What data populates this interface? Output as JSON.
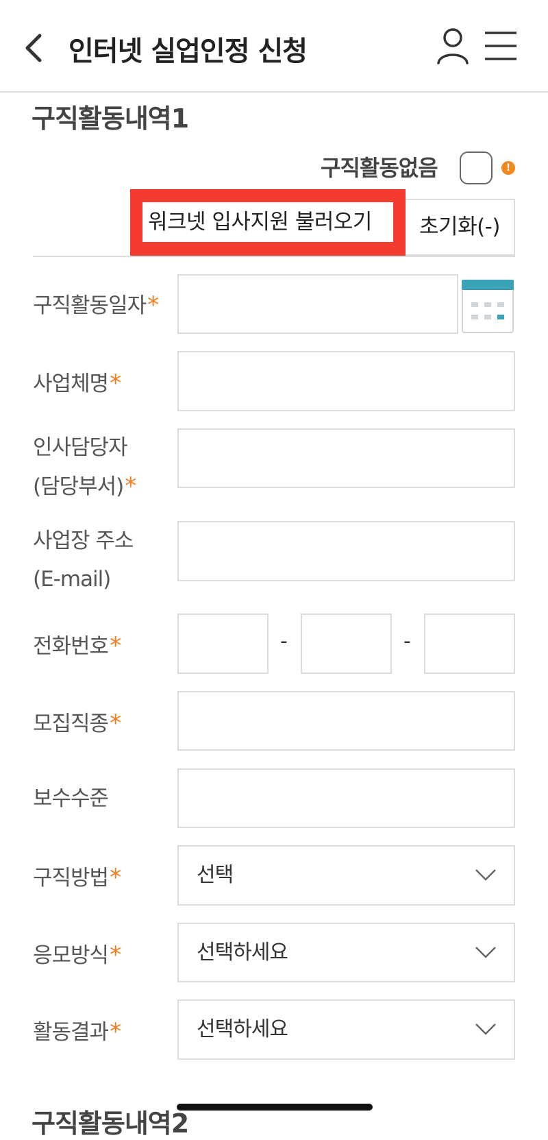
{
  "header": {
    "title": "인터넷 실업인정 신청"
  },
  "section": {
    "title": "구직활동내역1",
    "no_activity_label": "구직활동없음",
    "worknet_button": "워크넷 입사지원 불러오기",
    "reset_button": "초기화(-)"
  },
  "form": {
    "required_mark": "*",
    "activity_date_label": "구직활동일자",
    "company_name_label": "사업체명",
    "hr_manager_label": [
      "인사담당자",
      "(담당부서)"
    ],
    "address_label": [
      "사업장 주소",
      "(E-mail)"
    ],
    "phone_label": "전화번호",
    "phone_separator": "-",
    "job_type_label": "모집직종",
    "salary_label": "보수수준",
    "job_method_label": "구직방법",
    "job_method_value": "선택",
    "apply_method_label": "응모방식",
    "apply_method_value": "선택하세요",
    "result_label": "활동결과",
    "result_value": "선택하세요"
  },
  "next_section": {
    "title": "구직활동내역2"
  },
  "colors": {
    "accent": "#ef7d22",
    "highlight": "#f43b2f",
    "calendar": "#3aa3b8"
  },
  "icons": [
    "back-icon",
    "user-icon",
    "menu-icon",
    "info-icon",
    "calendar-icon",
    "chevron-down-icon"
  ]
}
